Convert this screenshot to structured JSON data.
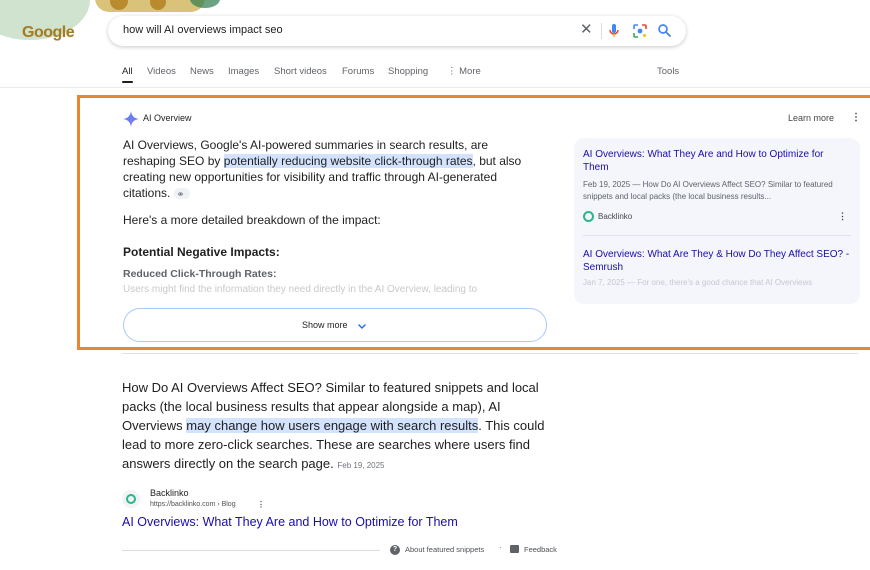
{
  "header": {
    "logo_text": "Google",
    "search_query": "how will AI overviews impact seo",
    "icons": [
      "clear-icon",
      "mic-icon",
      "lens-icon",
      "search-icon"
    ]
  },
  "tabs": [
    {
      "label": "All",
      "active": true
    },
    {
      "label": "Videos"
    },
    {
      "label": "News"
    },
    {
      "label": "Images"
    },
    {
      "label": "Short videos"
    },
    {
      "label": "Forums"
    },
    {
      "label": "Shopping"
    },
    {
      "label": "⋮ More"
    },
    {
      "label": "Tools"
    }
  ],
  "ai_overview": {
    "title": "AI Overview",
    "learn_more": "Learn more",
    "intro_before": "AI Overviews, Google's AI-powered summaries in search results, are reshaping SEO by ",
    "intro_highlight": "potentially reducing website click-through rates",
    "intro_after": ", but also creating new opportunities for visibility and traffic through AI-generated citations.",
    "breakdown": "Here's a more detailed breakdown of the impact:",
    "heading_negative": "Potential Negative Impacts:",
    "subheading_ctr": "Reduced Click-Through Rates:",
    "faded_text": "Users might find the information they need directly in the AI Overview, leading to",
    "show_more": "Show more",
    "sources": [
      {
        "title": "AI Overviews: What They Are and How to Optimize for Them",
        "snippet": "Feb 19, 2025 — How Do AI Overviews Affect SEO? Similar to featured snippets and local packs (the local business results...",
        "site": "Backlinko"
      },
      {
        "title": "AI Overviews: What Are They & How Do They Affect SEO? - Semrush",
        "snippet": "Jan 7, 2025 — For one, there's a good chance that AI Overviews"
      }
    ],
    "accent_color": "#e9862f"
  },
  "featured_snippet": {
    "text_before": "How Do AI Overviews Affect SEO? Similar to featured snippets and local packs (the local business results that appear alongside a map), AI Overviews ",
    "text_highlight": "may change how users engage with search results",
    "text_after": ". This could lead to more zero-click searches. These are searches where users find answers directly on the search page.",
    "date": "Feb 19, 2025",
    "site_name": "Backlinko",
    "site_url": "https://backlinko.com › Blog",
    "result_title": "AI Overviews: What They Are and How to Optimize for Them",
    "about_label": "About featured snippets",
    "separator": "·",
    "feedback_label": "Feedback"
  }
}
